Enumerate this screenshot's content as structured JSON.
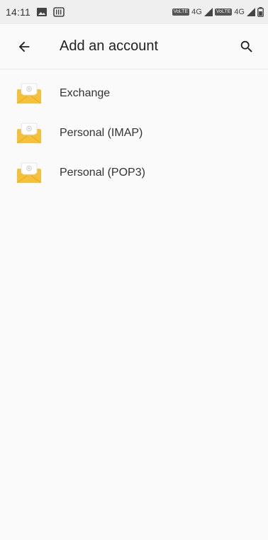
{
  "status_bar": {
    "time": "14:11",
    "network_1": "4G",
    "network_2": "4G",
    "volte": "VoLTE"
  },
  "app_bar": {
    "title": "Add an account"
  },
  "accounts": [
    {
      "label": "Exchange",
      "icon": "mail-envelope-icon"
    },
    {
      "label": "Personal (IMAP)",
      "icon": "mail-envelope-icon"
    },
    {
      "label": "Personal (POP3)",
      "icon": "mail-envelope-icon"
    }
  ],
  "colors": {
    "envelope": "#f6c13a",
    "envelope_dark": "#e7a91f",
    "status_bar_bg": "#efefef",
    "background": "#fafafa"
  }
}
